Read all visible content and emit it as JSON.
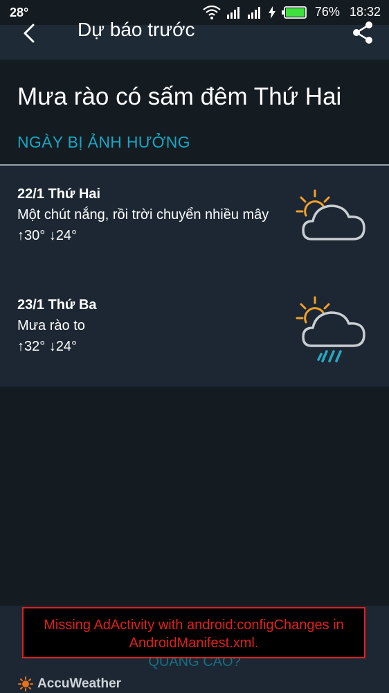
{
  "status_bar": {
    "temperature": "28°",
    "battery_percent": "76%",
    "time": "18:32",
    "icons": [
      "wifi-icon",
      "signal-icon",
      "signal-icon",
      "charging-icon",
      "battery-icon"
    ]
  },
  "toolbar": {
    "title": "Dự báo trước",
    "back_icon": "back-arrow-icon",
    "share_icon": "share-icon"
  },
  "headline": "Mưa rào có sấm đêm Thứ Hai",
  "section_label": "NGÀY BỊ ẢNH HƯỞNG",
  "days": [
    {
      "date": "22/1 Thứ Hai",
      "description": "Một chút nắng, rồi trời chuyển nhiều mây",
      "high": "↑30°",
      "low": "↓24°",
      "icon": "partly-sunny-cloud-icon"
    },
    {
      "date": "23/1 Thứ Ba",
      "description": "Mưa rào to",
      "high": "↑32°",
      "low": "↓24°",
      "icon": "sun-cloud-rain-icon"
    }
  ],
  "ad": {
    "error_message": "Missing AdActivity with android:configChanges in AndroidManifest.xml.",
    "question_label": "QUẢNG CÁO?"
  },
  "footer": {
    "brand": "AccuWeather",
    "logo_icon": "accuweather-sun-icon"
  },
  "colors": {
    "background": "#141b21",
    "toolbar": "#1e2a35",
    "panel": "#1c2733",
    "accent": "#1aa6c2",
    "sun": "#f5a02a",
    "rain": "#2aa8c0",
    "error": "#e0201b",
    "battery": "#3ee03e"
  }
}
